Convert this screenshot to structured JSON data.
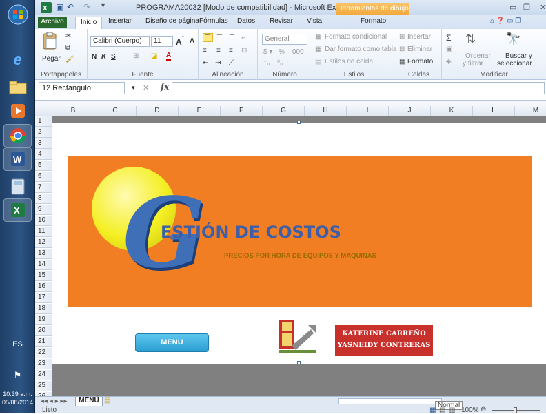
{
  "taskbar": {
    "lang": "ES",
    "time": "10:39 a.m.",
    "date": "05/08/2014"
  },
  "window": {
    "title": "PROGRAMA20032  [Modo de compatibilidad]  -  Microsoft Excel",
    "context_tab": "Herramientas de dibujo"
  },
  "tabs": [
    "Archivo",
    "Inicio",
    "Insertar",
    "Diseño de página",
    "Fórmulas",
    "Datos",
    "Revisar",
    "Vista",
    "Formato"
  ],
  "ribbon": {
    "portapapeles": {
      "label": "Portapapeles",
      "pegar": "Pegar"
    },
    "fuente": {
      "label": "Fuente",
      "font": "Calibri (Cuerpo)",
      "size": "11",
      "bold": "N",
      "italic": "K",
      "underline": "S"
    },
    "alineacion": {
      "label": "Alineación"
    },
    "numero": {
      "label": "Número",
      "format": "General",
      "pct": "%",
      "thousands": "000"
    },
    "estilos": {
      "label": "Estilos",
      "cond": "Formato condicional",
      "tabla": "Dar formato como tabla",
      "celda": "Estilos de celda"
    },
    "celdas": {
      "label": "Celdas",
      "insertar": "Insertar",
      "eliminar": "Eliminar",
      "formato": "Formato"
    },
    "modificar": {
      "label": "Modificar",
      "ordenar1": "Ordenar",
      "ordenar2": "y filtrar",
      "buscar1": "Buscar y",
      "buscar2": "seleccionar"
    }
  },
  "formula_bar": {
    "name_box": "12 Rectángulo",
    "fx": "fx"
  },
  "columns": [
    "B",
    "C",
    "D",
    "E",
    "F",
    "G",
    "H",
    "I",
    "J",
    "K",
    "L",
    "M"
  ],
  "rows": [
    "1",
    "2",
    "3",
    "4",
    "5",
    "6",
    "7",
    "8",
    "9",
    "10",
    "11",
    "12",
    "13",
    "14",
    "15",
    "16",
    "17",
    "18",
    "19",
    "20",
    "21",
    "22",
    "23",
    "24",
    "25",
    "26"
  ],
  "content": {
    "gestion": "ESTIÓN DE COSTOS",
    "subtitle": "PRECIOS POR HORA DE EQUIPOS Y MAQUINAS",
    "menu_button": "MENU",
    "name1": "KATERINE CARREÑO",
    "name2": "YASNEIDY CONTRERAS"
  },
  "status": {
    "sheet": "MENÚ",
    "listo": "Listo",
    "view_tooltip": "Normal",
    "zoom": "100%"
  }
}
